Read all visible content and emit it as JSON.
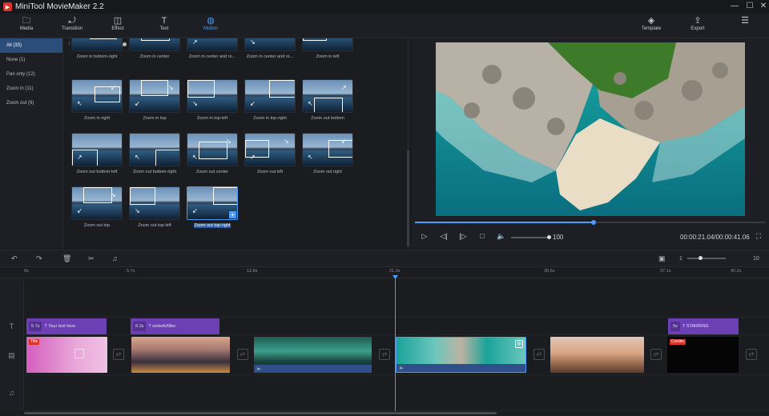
{
  "app": {
    "title": "MiniTool MovieMaker 2.2"
  },
  "toolbar": {
    "media": "Media",
    "transition": "Transition",
    "effect": "Effect",
    "text": "Text",
    "motion": "Motion",
    "template": "Template",
    "export": "Export",
    "active": "Motion"
  },
  "categories": [
    {
      "label": "All (33)",
      "active": true
    },
    {
      "label": "None (1)"
    },
    {
      "label": "Pan only (12)"
    },
    {
      "label": "Zoom in (11)"
    },
    {
      "label": "Zoom out (9)"
    }
  ],
  "motion_slider": {
    "min": "1",
    "max": "100"
  },
  "motions": [
    "Zoom in bottom-right",
    "Zoom in center",
    "Zoom in center and ro...",
    "Zoom in center and ro...",
    "Zoom in left",
    "Zoom in right",
    "Zoom in top",
    "Zoom in top-left",
    "Zoom in top-right",
    "Zoom out bottom",
    "Zoom out bottom-left",
    "Zoom out bottom-right",
    "Zoom out center",
    "Zoom out left",
    "Zoom out right",
    "Zoom out top",
    "Zoom out top-left",
    "Zoom out top-right"
  ],
  "selected_motion": "Zoom out top-right",
  "player": {
    "volume": "100",
    "timecode": "00:00:21.04/00:00:41.06",
    "progress": 0.51
  },
  "timeline": {
    "zoom_min": "1",
    "zoom_max": "10",
    "ruler": [
      "0s",
      "5.7s",
      "12.8s",
      "21.2s",
      "30.5s",
      "37.1s",
      "42.2s"
    ],
    "text_clips": [
      {
        "duration": "5.7s",
        "label": "Your text here"
      },
      {
        "duration": "8.3s",
        "label": "webvfx/filter"
      },
      {
        "duration": "5s",
        "label": "STARRING"
      }
    ],
    "video_badges": {
      "title": "Title",
      "credits": "Credits"
    }
  },
  "icons": {
    "media": "folder-icon",
    "transition": "transition-icon",
    "effect": "effect-icon",
    "text": "text-icon",
    "motion": "motion-icon",
    "template": "layers-icon",
    "export": "export-icon",
    "menu": "hamburger-icon"
  },
  "colors": {
    "accent": "#4d9cf5",
    "text_clip": "#6c3fb4",
    "badge": "#d8342c"
  }
}
